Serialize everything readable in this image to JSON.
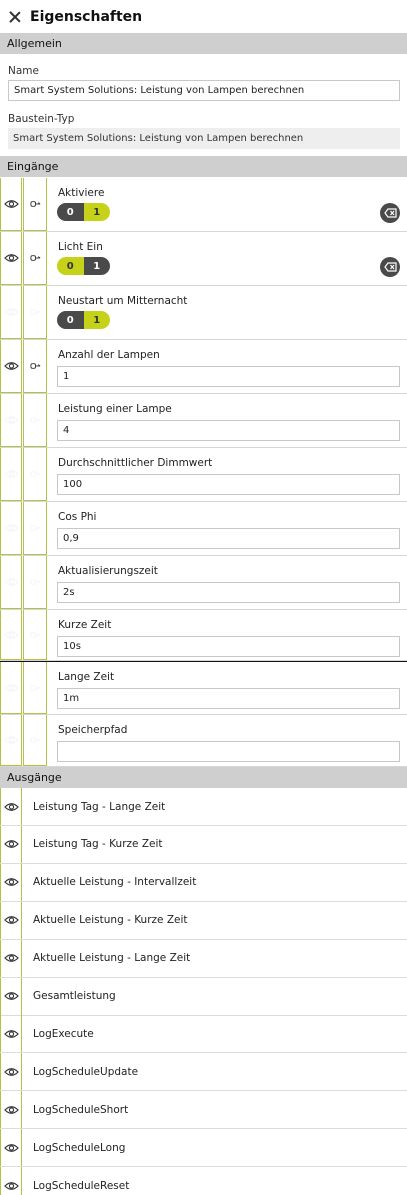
{
  "header": {
    "title": "Eigenschaften"
  },
  "allgemein": {
    "section_label": "Allgemein",
    "name_label": "Name",
    "name_value": "Smart System Solutions: Leistung von Lampen berechnen",
    "type_label": "Baustein-Typ",
    "type_value": "Smart System Solutions: Leistung von Lampen berechnen"
  },
  "eingaenge": {
    "section_label": "Eingänge",
    "rows": [
      {
        "label": "Aktiviere",
        "kind": "toggle",
        "off": "0",
        "on": "1",
        "active": "1",
        "clearable": true,
        "dim": false
      },
      {
        "label": "Licht Ein",
        "kind": "toggle",
        "off": "0",
        "on": "1",
        "active": "0",
        "clearable": true,
        "dim": false
      },
      {
        "label": "Neustart um Mitternacht",
        "kind": "toggle",
        "off": "0",
        "on": "1",
        "active": "1",
        "clearable": false,
        "dim": true
      },
      {
        "label": "Anzahl der Lampen",
        "kind": "input",
        "value": "1",
        "dim": false
      },
      {
        "label": "Leistung einer Lampe",
        "kind": "input",
        "value": "4",
        "dim": true
      },
      {
        "label": "Durchschnittlicher Dimmwert",
        "kind": "input",
        "value": "100",
        "dim": true
      },
      {
        "label": "Cos Phi",
        "kind": "input",
        "value": "0,9",
        "dim": true
      },
      {
        "label": "Aktualisierungszeit",
        "kind": "input",
        "value": "2s",
        "dim": true
      },
      {
        "label": "Kurze Zeit",
        "kind": "input",
        "value": "10s",
        "dim": true
      },
      {
        "label": "Lange Zeit",
        "kind": "input",
        "value": "1m",
        "dim": true
      },
      {
        "label": "Speicherpfad",
        "kind": "input",
        "value": "",
        "dim": true
      }
    ]
  },
  "ausgaenge": {
    "section_label": "Ausgänge",
    "rows": [
      "Leistung Tag - Lange Zeit",
      "Leistung Tag - Kurze Zeit",
      "Aktuelle Leistung - Intervallzeit",
      "Aktuelle Leistung - Kurze Zeit",
      "Aktuelle Leistung - Lange Zeit",
      "Gesamtleistung",
      "LogExecute",
      "LogScheduleUpdate",
      "LogScheduleShort",
      "LogScheduleLong",
      "LogScheduleReset"
    ]
  },
  "icons": {
    "visibility": "eye-icon",
    "input_connector": "plug-icon",
    "clear": "clear-value-icon",
    "close": "close-icon"
  },
  "colors": {
    "accent": "#c5d219",
    "border_accent": "#b5c24a",
    "toggle_dark": "#4a4a4a",
    "section_bg": "#cfcfcf"
  }
}
